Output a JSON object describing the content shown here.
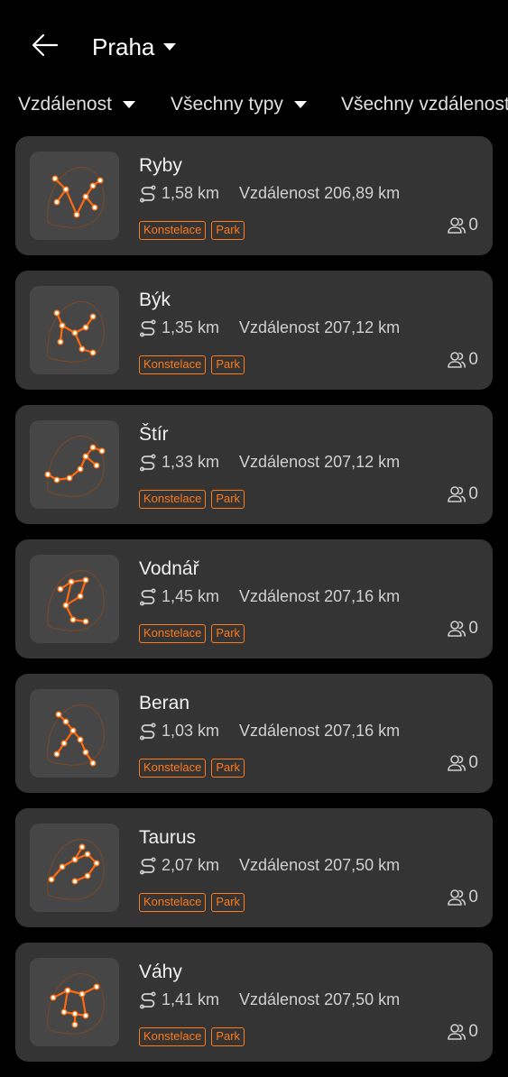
{
  "header": {
    "city": "Praha"
  },
  "filters": [
    {
      "label": "Vzdálenost"
    },
    {
      "label": "Všechny typy"
    },
    {
      "label": "Všechny vzdálenosti"
    }
  ],
  "items": [
    {
      "name": "Ryby",
      "route": "1,58 km",
      "distance": "Vzdálenost 206,89 km",
      "tags": [
        "Konstelace",
        "Park"
      ],
      "people": "0"
    },
    {
      "name": "Býk",
      "route": "1,35 km",
      "distance": "Vzdálenost 207,12 km",
      "tags": [
        "Konstelace",
        "Park"
      ],
      "people": "0"
    },
    {
      "name": "Štír",
      "route": "1,33 km",
      "distance": "Vzdálenost 207,12 km",
      "tags": [
        "Konstelace",
        "Park"
      ],
      "people": "0"
    },
    {
      "name": "Vodnář",
      "route": "1,45 km",
      "distance": "Vzdálenost 207,16 km",
      "tags": [
        "Konstelace",
        "Park"
      ],
      "people": "0"
    },
    {
      "name": "Beran",
      "route": "1,03 km",
      "distance": "Vzdálenost 207,16 km",
      "tags": [
        "Konstelace",
        "Park"
      ],
      "people": "0"
    },
    {
      "name": "Taurus",
      "route": "2,07 km",
      "distance": "Vzdálenost 207,50 km",
      "tags": [
        "Konstelace",
        "Park"
      ],
      "people": "0"
    },
    {
      "name": "Váhy",
      "route": "1,41 km",
      "distance": "Vzdálenost 207,50 km",
      "tags": [
        "Konstelace",
        "Park"
      ],
      "people": "0"
    }
  ],
  "colors": {
    "accent": "#ff7a1a",
    "card": "#343434",
    "background": "#000000"
  },
  "icons": {
    "back": "back-arrow-icon",
    "dropdown": "caret-down-icon",
    "route": "route-icon",
    "people": "people-icon"
  }
}
